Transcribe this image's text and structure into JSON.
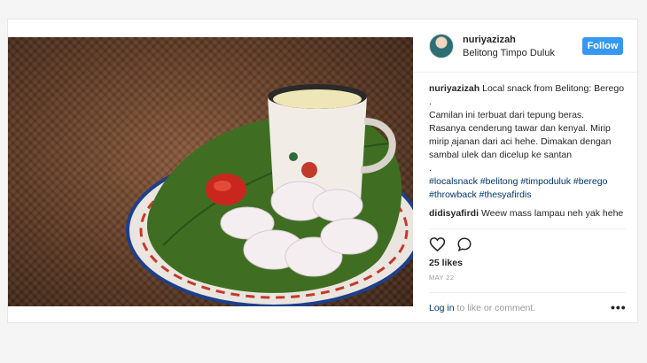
{
  "post": {
    "username": "nuriyazizah",
    "location": "Belitong Timpo Duluk",
    "follow_label": "Follow",
    "caption": {
      "username": "nuriyazizah",
      "lines": [
        "Local snack from Belitong: Berego",
        ".",
        "Camilan ini terbuat dari tepung beras.",
        "Rasanya cenderung tawar dan kenyal. Mirip",
        "mirip ̦ajanan dari aci hehe. Dimakan dengan",
        "sambal ulek dan dicelup ke santan",
        "."
      ],
      "hashtags_line1": [
        "#localsnack",
        "#belitong",
        "#timpoduluk",
        "#berego"
      ],
      "hashtags_line2": [
        "#throwback",
        "#thesyafirdis"
      ]
    },
    "comment": {
      "username": "didisyafirdi",
      "text": "Weew mass lampau neh yak hehe"
    },
    "likes": "25 likes",
    "date": "MAY 22",
    "login_link": "Log in",
    "login_text": "to like or comment.",
    "more_label": "•••"
  },
  "icons": {
    "like": "heart-icon",
    "comment": "comment-bubble-icon",
    "options": "more-options-icon"
  },
  "colors": {
    "accent": "#3897f0",
    "link": "#003569",
    "muted": "#999999"
  }
}
